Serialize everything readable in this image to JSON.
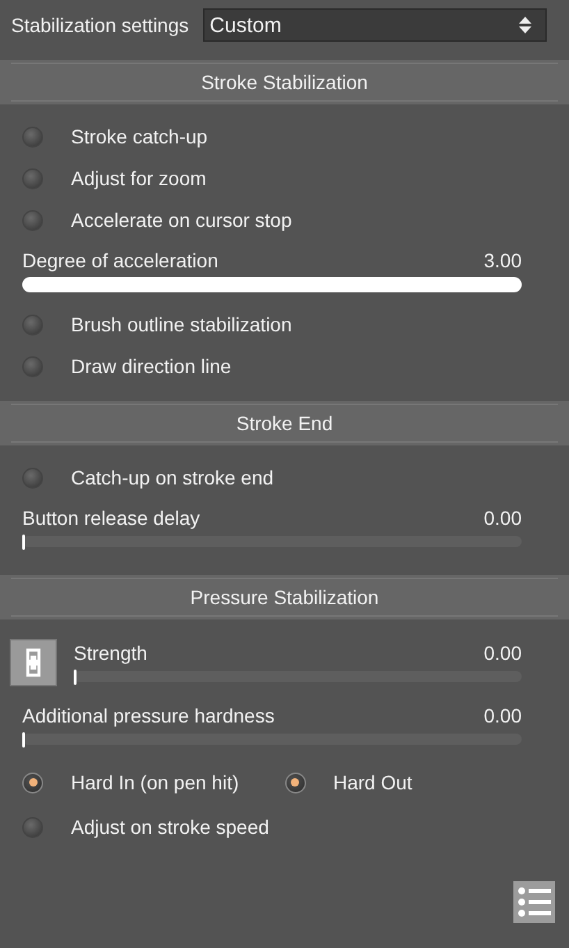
{
  "header": {
    "label": "Stabilization settings",
    "value": "Custom"
  },
  "sections": [
    {
      "title": "Stroke Stabilization",
      "items": [
        {
          "kind": "toggle",
          "label": "Stroke catch-up",
          "on": false
        },
        {
          "kind": "toggle",
          "label": "Adjust for zoom",
          "on": false
        },
        {
          "kind": "toggle",
          "label": "Accelerate on cursor stop",
          "on": false
        },
        {
          "kind": "slider",
          "label": "Degree of acceleration",
          "value": "3.00",
          "level": 1
        },
        {
          "kind": "toggle",
          "label": "Brush outline stabilization",
          "on": false
        },
        {
          "kind": "toggle",
          "label": "Draw direction line",
          "on": false
        }
      ]
    },
    {
      "title": "Stroke End",
      "items": [
        {
          "kind": "toggle",
          "label": "Catch-up on stroke end",
          "on": false
        },
        {
          "kind": "slider",
          "label": "Button release delay",
          "value": "0.00",
          "level": 0
        }
      ]
    },
    {
      "title": "Pressure Stabilization",
      "items": [
        {
          "kind": "linked_slider",
          "label": "Strength",
          "value": "0.00",
          "level": 0
        },
        {
          "kind": "slider",
          "label": "Additional pressure hardness",
          "value": "0.00",
          "level": 0
        },
        {
          "kind": "toggle_pair",
          "toggles": [
            {
              "label": "Hard In (on pen hit)",
              "on": true
            },
            {
              "label": "Hard Out",
              "on": true
            }
          ]
        },
        {
          "kind": "toggle",
          "label": "Adjust on stroke speed",
          "on": false
        }
      ]
    }
  ]
}
